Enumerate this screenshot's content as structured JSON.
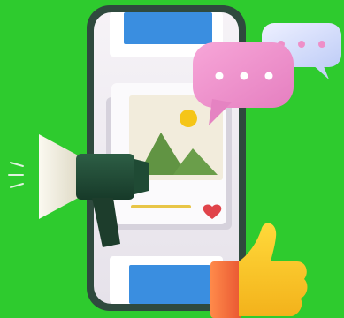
{
  "illustration": {
    "background_color": "#2ecb2e",
    "phone": {
      "frame_color": "#2f4a3e",
      "screen_color": "#f1eef3",
      "top_banner_color": "#3a8ee0",
      "bottom_banner_color": "#3a8ee0"
    },
    "post_card": {
      "image_icon": "landscape-picture-icon",
      "sun_color": "#f5c518",
      "mountain_color": "#6a9e4a",
      "caption_line_color": "#e8c547",
      "like_icon": "heart-icon",
      "like_color": "#e0434a"
    },
    "chat_bubbles": [
      {
        "icon": "chat-bubble-icon",
        "color": "#ee8fc8"
      },
      {
        "icon": "chat-bubble-icon",
        "color": "#d9e0fb"
      }
    ],
    "megaphone": {
      "icon": "megaphone-icon",
      "body_color": "#1f4a34",
      "cone_color": "#f4f1e6"
    },
    "thumbs_up": {
      "icon": "thumbs-up-icon",
      "color": "#f7c928",
      "cuff_color": "#f26a3a"
    }
  }
}
